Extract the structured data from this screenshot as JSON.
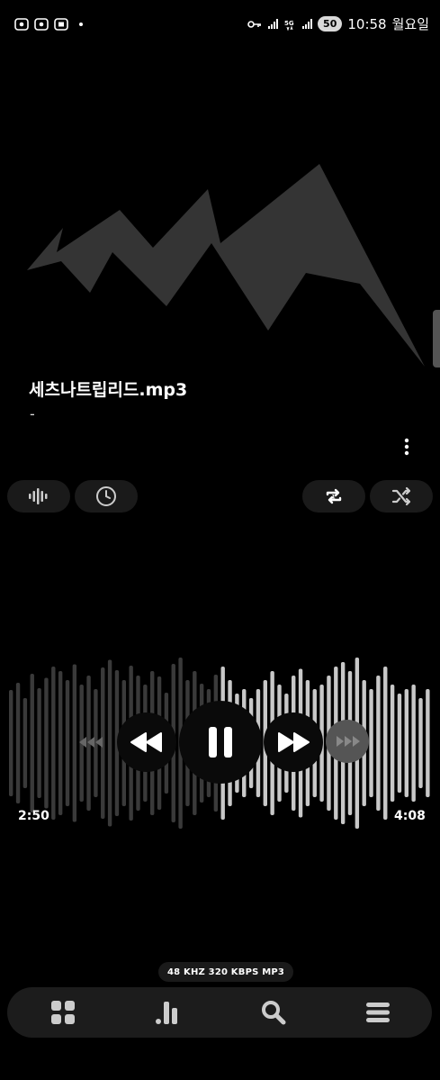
{
  "status_bar": {
    "time": "10:58",
    "day": "월요일",
    "battery": "50",
    "network": "5G",
    "left_icons": [
      "screenshot-icon",
      "screenshot-icon",
      "screen-record-icon"
    ],
    "right_icons": [
      "key-icon",
      "signal-icon",
      "5g-icon",
      "signal-icon",
      "battery-icon"
    ]
  },
  "track": {
    "title": "세츠나트립리드.mp3",
    "artist": "-"
  },
  "controls": {
    "elapsed": "2:50",
    "duration": "4:08",
    "progress_fraction": 0.5
  },
  "format": {
    "sample_rate": "48 KHZ",
    "bitrate": "320 KBPS",
    "codec": "MP3"
  },
  "icons": {
    "options": [
      "equalizer-icon",
      "sleep-timer-icon",
      "repeat-icon",
      "shuffle-icon"
    ],
    "nav": [
      "grid-icon",
      "stats-icon",
      "search-icon",
      "menu-icon"
    ]
  }
}
